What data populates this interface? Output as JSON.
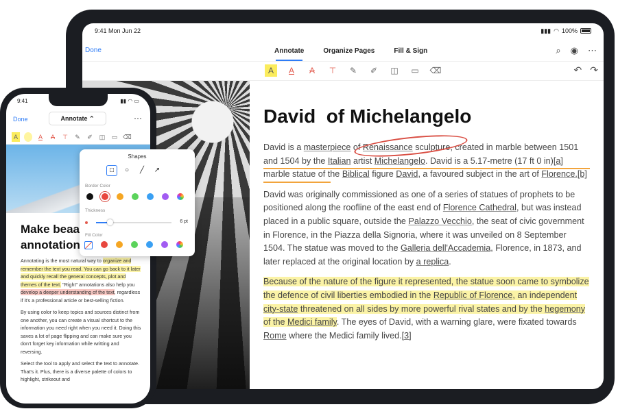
{
  "ipad": {
    "status": {
      "time": "9:41  Mon Jun 22",
      "battery": "100%"
    },
    "nav": {
      "done": "Done",
      "tabs": [
        {
          "label": "Annotate"
        },
        {
          "label": "Organize Pages"
        },
        {
          "label": "Fill & Sign"
        }
      ]
    },
    "toolbar_icons": [
      "highlight-icon",
      "underline-icon",
      "strikethrough-icon",
      "text-box-icon",
      "pen-icon",
      "marker-icon",
      "shapes-icon",
      "comment-icon",
      "eraser-icon"
    ],
    "document": {
      "title": "David  of Michelangelo",
      "p1": {
        "a": "David is a ",
        "masterpiece": "masterpiece",
        "b": " of ",
        "renaissance": "Renaissance",
        "c": " sculpture, created in marble between 1501 and 1504 by the ",
        "italian": "Italian",
        "d": " artist ",
        "michelangelo": "Michelangelo",
        "e": ". David is a 5.17-metre (17 ft 0 in)",
        "ref_a": "[a]",
        "f": " marble statue of the ",
        "biblical": "Biblical",
        "g": " figure ",
        "david": "David",
        "h": ", a favoured subject in the art of ",
        "florence": "Florence",
        "ref_b": ".[b]"
      },
      "p2": {
        "a": "David was originally commissioned as one of a series of statues of prophets to be positioned along the roofline of the east end of ",
        "cathedral": "Florence Cathedral",
        "b": ", but was instead placed in a public square, outside the ",
        "palazzo": "Palazzo Vecchio",
        "c": ", the seat of civic government in Florence, in the Piazza della Signoria, where it was unveiled on 8 September 1504. The statue was moved to the ",
        "galleria": "Galleria dell'Accademia",
        "d": ", Florence, in 1873, and later replaced at the original location by ",
        "replica": "a replica",
        "e": "."
      },
      "p3": {
        "a": "Because of the nature of the figure it represented, the statue soon came to symbolize the defence of civil liberties embodied in the ",
        "republic": "Republic of Florence",
        "b": ", an independent ",
        "citystate": "city-state",
        "c": " threatened on all sides by more powerful rival states and by the ",
        "hegemony": "hegemony",
        "d": " of the ",
        "medici": "Medici family",
        "e": ". The eyes of David, with a warning glare, were fixated towards ",
        "rome": "Rome",
        "f": " where the Medici family lived.",
        "ref": "[3]"
      }
    }
  },
  "iphone": {
    "status": {
      "time": "9:41"
    },
    "nav": {
      "done": "Done",
      "mode": "Annotate"
    },
    "document": {
      "title": "Make beautiful annotation",
      "title_line1": "Make beaa",
      "title_line2": "annotation",
      "p1": {
        "a": "Annotating is the most natural way to ",
        "b": "organize and remember the text you read. You can go back to it later and quickly recall the general concepts, plot and themes of the text.",
        "c": " \"Right\" annotations also help you ",
        "d": "develop a deeper understanding of the text",
        "e": ", regardless if it's a professional article or best-selling fiction."
      },
      "p2": "By using color to keep topics and sources distinct from one another, you can create a visual shortcut to the information you need right when you need it. Doing this saves a lot of page flipping and can make sure you don't forget key information while writting and reversing.",
      "p3": "Select the tool to apply and select the text to annotate. That's it. Plus, there is a diverse palette of colors to highlight, strikeout and"
    }
  },
  "popover": {
    "title": "Shapes",
    "shapes": [
      "rectangle-icon",
      "circle-icon",
      "line-icon",
      "arrow-icon"
    ],
    "border_color_label": "Border Color",
    "thickness_label": "Thickness",
    "thickness_value": "6 pt",
    "thickness_fraction": 0.18,
    "fill_color_label": "Fill Color",
    "colors": [
      "#111111",
      "#e8473e",
      "#f5a623",
      "#5bd35b",
      "#3aa0f3",
      "#a25cf2"
    ]
  }
}
